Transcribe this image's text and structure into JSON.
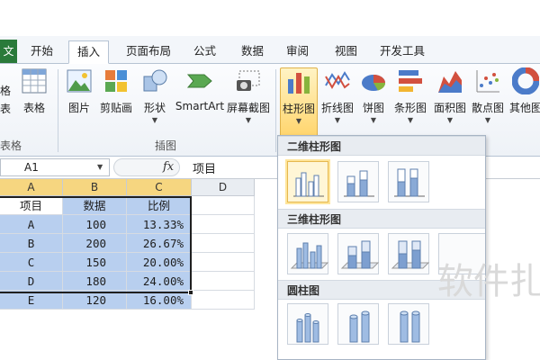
{
  "tabs": {
    "file": "文件",
    "items": [
      "开始",
      "插入",
      "页面布局",
      "公式",
      "数据",
      "审阅",
      "视图",
      "开发工具"
    ],
    "active_index": 1
  },
  "ribbon": {
    "left_partial": {
      "top": "格",
      "bottom": "表"
    },
    "table_label": "表格",
    "group_tables": "表格",
    "group_illustrations": "插图",
    "illustrations": [
      "图片",
      "剪贴画",
      "形状",
      "SmartArt",
      "屏幕截图"
    ],
    "charts": [
      "柱形图",
      "折线图",
      "饼图",
      "条形图",
      "面积图",
      "散点图",
      "其他图"
    ],
    "selected_chart_index": 0
  },
  "formula_bar": {
    "cell_ref": "A1",
    "fx": "fx",
    "value": "项目"
  },
  "sheet": {
    "columns": [
      "A",
      "B",
      "C",
      "D"
    ],
    "rows": [
      [
        "项目",
        "数据",
        "比例"
      ],
      [
        "A",
        "100",
        "13.33%"
      ],
      [
        "B",
        "200",
        "26.67%"
      ],
      [
        "C",
        "150",
        "20.00%"
      ],
      [
        "D",
        "180",
        "24.00%"
      ],
      [
        "E",
        "120",
        "16.00%"
      ]
    ],
    "selection_color": "#b8cfef"
  },
  "gallery": {
    "sections": [
      "二维柱形图",
      "三维柱形图",
      "圆柱图"
    ]
  },
  "watermark": "软件扎"
}
